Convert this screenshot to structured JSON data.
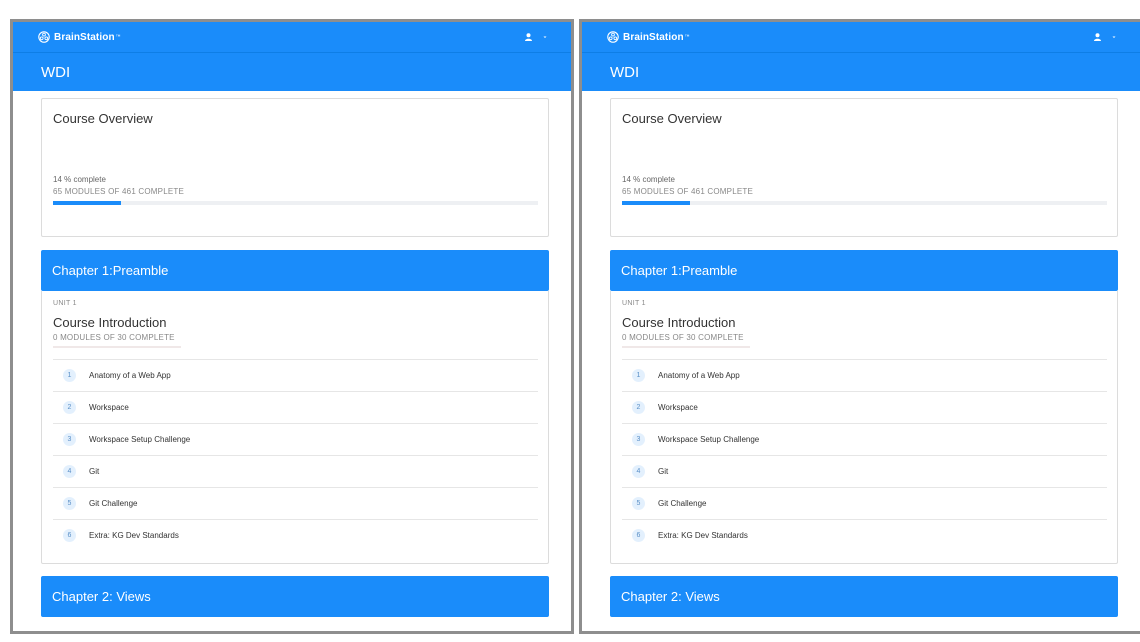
{
  "brand": {
    "name": "BrainStation",
    "trademark": "™"
  },
  "header": {
    "course_title": "WDI"
  },
  "overview": {
    "title": "Course Overview",
    "percent_text": "14 % complete",
    "modules_text": "65 MODULES OF 461 COMPLETE",
    "progress_fraction": 0.14
  },
  "chapters": [
    {
      "title": "Chapter 1:Preamble"
    },
    {
      "title": "Chapter 2: Views"
    }
  ],
  "unit": {
    "label": "UNIT 1",
    "title": "Course Introduction",
    "modules_text": "0 MODULES OF 30 COMPLETE",
    "progress_fraction": 0.0
  },
  "lessons": [
    {
      "number": "1",
      "label": "Anatomy of a Web App"
    },
    {
      "number": "2",
      "label": "Workspace"
    },
    {
      "number": "3",
      "label": "Workspace Setup Challenge"
    },
    {
      "number": "4",
      "label": "Git"
    },
    {
      "number": "5",
      "label": "Git Challenge"
    },
    {
      "number": "6",
      "label": "Extra: KG Dev Standards"
    }
  ],
  "colors": {
    "accent": "#1a8cfa",
    "frame": "#8e8e8e"
  },
  "icons": {
    "logo": "brain-logo-icon",
    "user": "user-icon",
    "menu": "caret-down-icon"
  }
}
